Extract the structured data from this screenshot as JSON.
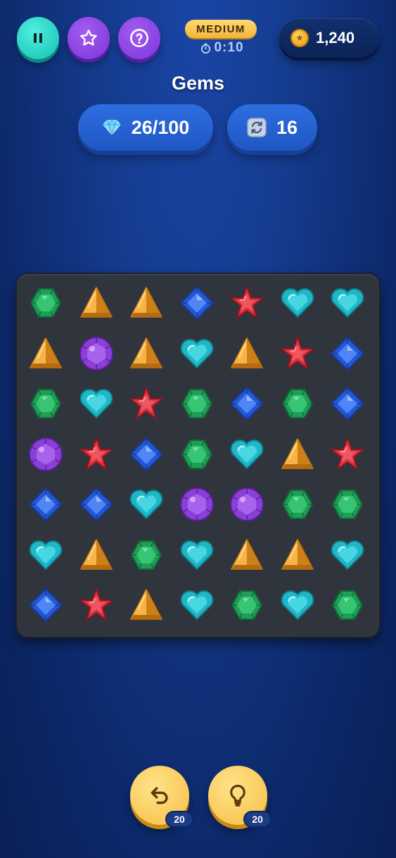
{
  "header": {
    "difficulty": "MEDIUM",
    "timer": "0:10",
    "coins": "1,240",
    "title": "Gems"
  },
  "stats": {
    "gems_collected": "26/100",
    "moves_left": "16"
  },
  "powerups": {
    "undo_count": "20",
    "hint_count": "20"
  },
  "board": {
    "rows": 7,
    "cols": 7,
    "cells": [
      [
        "emerald",
        "amber-pyramid",
        "amber-pyramid",
        "sapphire",
        "ruby-star",
        "aqua-heart",
        "aqua-heart"
      ],
      [
        "amber-pyramid",
        "amethyst",
        "amber-pyramid",
        "aqua-heart",
        "amber-pyramid",
        "ruby-star",
        "sapphire"
      ],
      [
        "emerald",
        "aqua-heart",
        "ruby-star",
        "emerald",
        "sapphire",
        "emerald",
        "sapphire"
      ],
      [
        "amethyst",
        "ruby-star",
        "sapphire",
        "emerald",
        "aqua-heart",
        "amber-pyramid",
        "ruby-star"
      ],
      [
        "sapphire",
        "sapphire",
        "aqua-heart",
        "amethyst",
        "amethyst",
        "emerald",
        "emerald"
      ],
      [
        "aqua-heart",
        "amber-pyramid",
        "emerald",
        "aqua-heart",
        "amber-pyramid",
        "amber-pyramid",
        "aqua-heart"
      ],
      [
        "sapphire",
        "ruby-star",
        "amber-pyramid",
        "aqua-heart",
        "emerald",
        "aqua-heart",
        "emerald"
      ]
    ]
  },
  "colors": {
    "background": "#143b8d",
    "board": "#30343d",
    "pause_button": "#22cfc0",
    "menu_button": "#8a45e0",
    "powerup_button": "#f7be42",
    "badge": "#1c3c86"
  },
  "icons": {
    "pause": "pause-icon",
    "star": "star-icon",
    "help": "question-icon",
    "timer": "stopwatch-icon",
    "coin": "coin-icon",
    "gems": "diamond-icon",
    "moves": "shuffle-icon",
    "undo": "undo-arrow-icon",
    "hint": "lightbulb-icon"
  }
}
